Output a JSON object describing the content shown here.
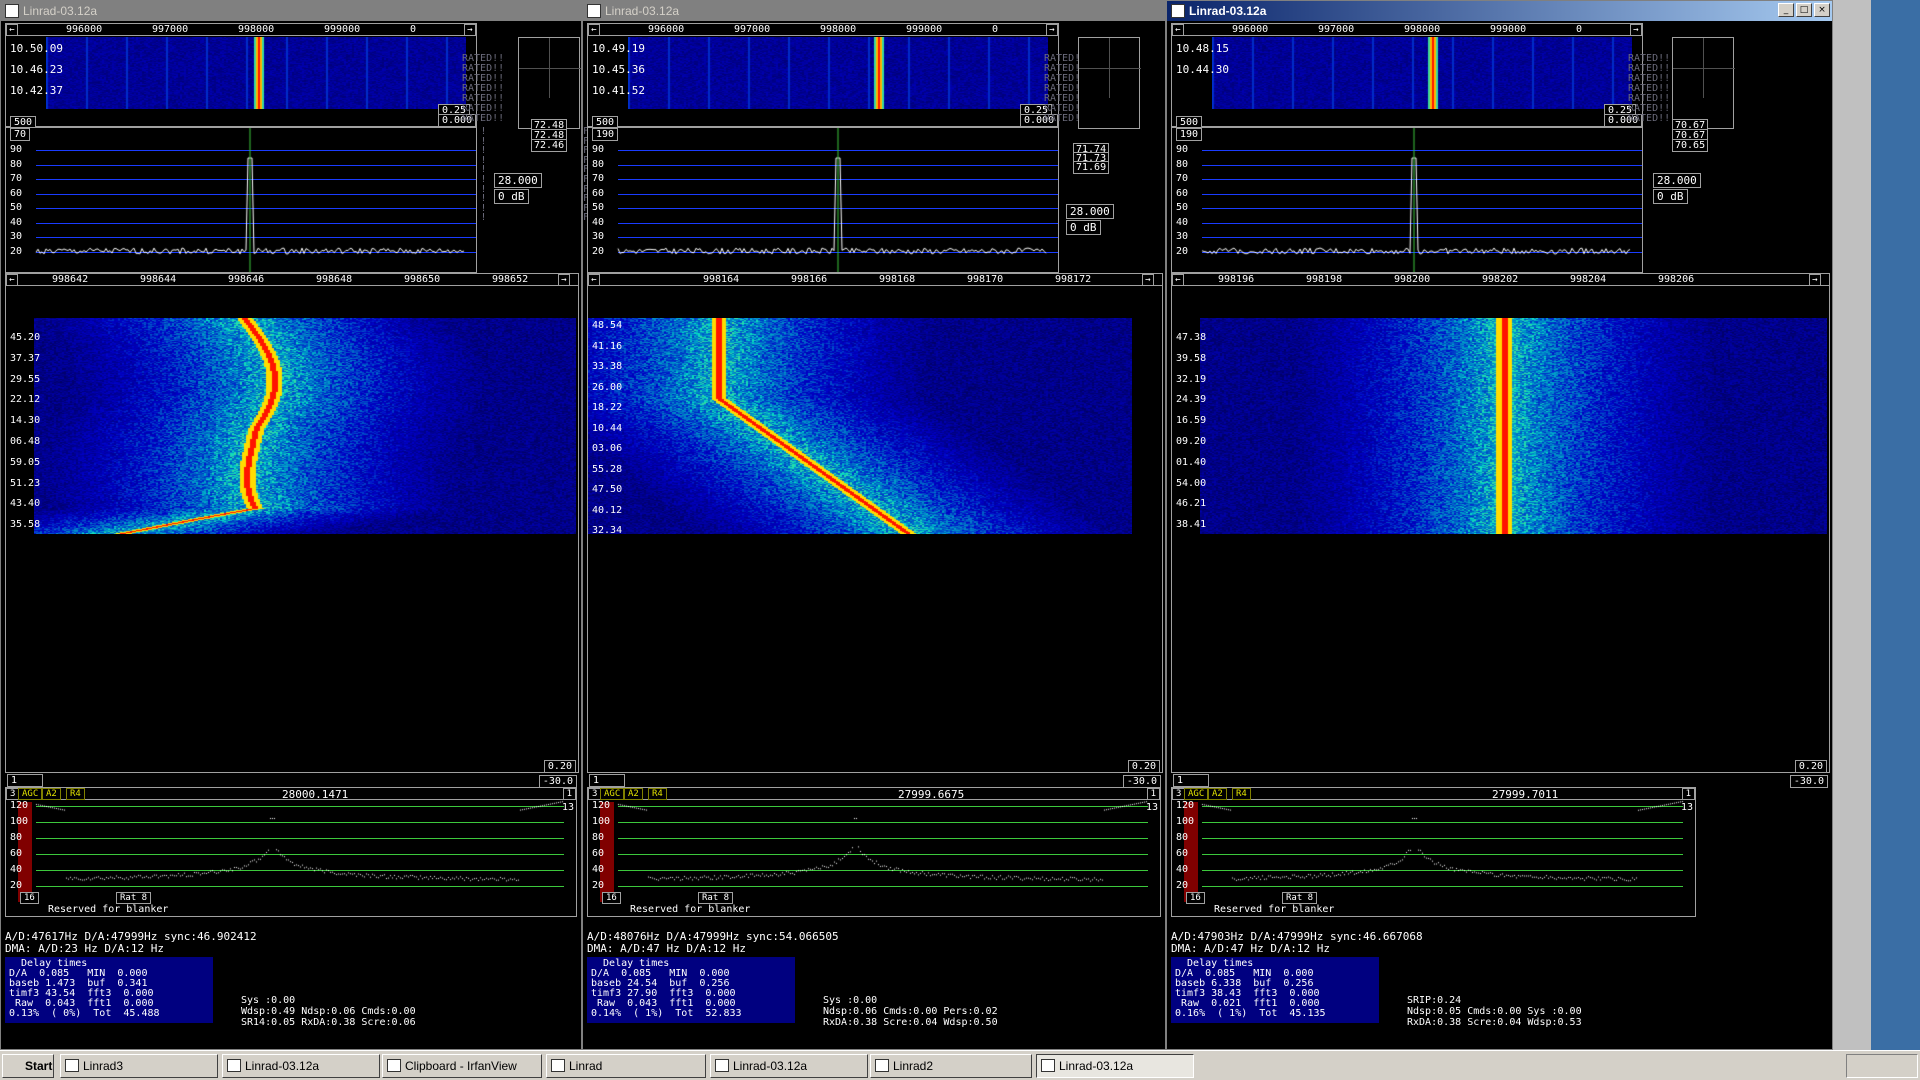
{
  "desktop": {
    "bg": "#3a6ea5"
  },
  "windows": [
    {
      "title": "Linrad-03.12a",
      "wide_scale": [
        "996000",
        "997000",
        "998000",
        "999000",
        "0"
      ],
      "times": [
        "10.50.09",
        "10.46.23",
        "10.42.37"
      ],
      "wf_box_top": "0.25",
      "wf_box_bot": "0.000",
      "left_box": "500",
      "left_box2": "70",
      "spec_ylabels": [
        "90",
        "80",
        "70",
        "60",
        "50",
        "40",
        "30",
        "20"
      ],
      "meter": [
        "72.48",
        "72.48",
        "72.46"
      ],
      "gain_box": "28.000",
      "db_box": "0 dB",
      "hires_scale": [
        "998642",
        "998644",
        "998646",
        "998648",
        "998650",
        "998652"
      ],
      "hires_times": [
        "45.20",
        "37.37",
        "29.55",
        "22.12",
        "14.30",
        "06.48",
        "59.05",
        "51.23",
        "43.40",
        "35.58"
      ],
      "bsd_top": "0.20",
      "bsd_bot": "-30.0",
      "one": "1",
      "freq": "28000.1471",
      "bsd_ylabels": [
        "120",
        "100",
        "80",
        "60",
        "40",
        "20"
      ],
      "agc": "AGC",
      "a2": "A2",
      "r4": "R4",
      "three": "3",
      "thirteen": "13",
      "ctrl": "Reserved for blanker",
      "ctrl_num": "16",
      "rat": "Rat  8",
      "status1": "A/D:47617Hz  D/A:47999Hz sync:46.902412",
      "status2": "DMA:  A/D:23 Hz    D/A:12 Hz",
      "delay": "  Delay times\nD/A  0.085   MIN  0.000\nbaseb 1.473  buf  0.341\ntimf3 43.54  fft3  0.000\n Raw  0.043  fft1  0.000\n0.13%  ( 0%)  Tot  45.488",
      "stats": [
        "Sys :0.00",
        "Wdsp:0.49  Ndsp:0.06  Cmds:0.00",
        "SR14:0.05  RxDA:0.38  Scre:0.06"
      ]
    },
    {
      "title": "Linrad-03.12a",
      "wide_scale": [
        "996000",
        "997000",
        "998000",
        "999000",
        "0"
      ],
      "times": [
        "10.49.19",
        "10.45.36",
        "10.41.52"
      ],
      "wf_box_top": "0.25",
      "wf_box_bot": "0.000",
      "left_box": "500",
      "left_box2": "190",
      "spec_ylabels": [
        "90",
        "80",
        "70",
        "60",
        "50",
        "40",
        "30",
        "20"
      ],
      "meter": [
        "71.74",
        "71.73",
        "71.69"
      ],
      "gain_box": "28.000",
      "db_box": "0 dB",
      "hires_scale": [
        "998164",
        "998166",
        "998168",
        "998170",
        "998172"
      ],
      "hires_times": [
        "48.54",
        "41.16",
        "33.38",
        "26.00",
        "18.22",
        "10.44",
        "03.06",
        "55.28",
        "47.50",
        "40.12",
        "32.34"
      ],
      "bsd_top": "0.20",
      "bsd_bot": "-30.0",
      "one": "1",
      "freq": "27999.6675",
      "bsd_ylabels": [
        "120",
        "100",
        "80",
        "60",
        "40",
        "20"
      ],
      "agc": "AGC",
      "a2": "A2",
      "r4": "R4",
      "three": "3",
      "thirteen": "13",
      "ctrl": "Reserved for blanker",
      "ctrl_num": "16",
      "rat": "Rat  8",
      "status1": "A/D:48076Hz  D/A:47999Hz sync:54.066505",
      "status2": "DMA:  A/D:47 Hz    D/A:12 Hz",
      "delay": "  Delay times\nD/A  0.085   MIN  0.000\nbaseb 24.54  buf  0.256\ntimf3 27.90  fft3  0.000\n Raw  0.043  fft1  0.000\n0.14%  ( 1%)  Tot  52.833",
      "stats": [
        "Sys :0.00",
        "Ndsp:0.06  Cmds:0.00  Pers:0.02",
        "RxDA:0.38  Scre:0.04  Wdsp:0.50"
      ]
    },
    {
      "title": "Linrad-03.12a",
      "wide_scale": [
        "996000",
        "997000",
        "998000",
        "999000",
        "0"
      ],
      "times": [
        "10.48.15",
        "10.44.30"
      ],
      "wf_box_top": "0.25",
      "wf_box_bot": "0.000",
      "left_box": "500",
      "left_box2": "190",
      "spec_ylabels": [
        "90",
        "80",
        "70",
        "60",
        "50",
        "40",
        "30",
        "20"
      ],
      "meter": [
        "70.67",
        "70.67",
        "70.65"
      ],
      "gain_box": "28.000",
      "db_box": "0 dB",
      "hires_scale": [
        "998196",
        "998198",
        "998200",
        "998202",
        "998204",
        "998206"
      ],
      "hires_times": [
        "47.38",
        "39.58",
        "32.19",
        "24.39",
        "16.59",
        "09.20",
        "01.40",
        "54.00",
        "46.21",
        "38.41"
      ],
      "bsd_top": "0.20",
      "bsd_bot": "-30.0",
      "one": "1",
      "freq": "27999.7011",
      "bsd_ylabels": [
        "120",
        "100",
        "80",
        "60",
        "40",
        "20"
      ],
      "agc": "AGC",
      "a2": "A2",
      "r4": "R4",
      "three": "3",
      "thirteen": "13",
      "ctrl": "Reserved for blanker",
      "ctrl_num": "16",
      "rat": "Rat  8",
      "status1": "A/D:47903Hz  D/A:47999Hz sync:46.667068",
      "status2": "DMA:  A/D:47 Hz    D/A:12 Hz",
      "delay": "  Delay times\nD/A  0.085   MIN  0.000\nbaseb 6.338  buf  0.256\ntimf3 38.43  fft3  0.000\n Raw  0.021  fft1  0.000\n0.16%  ( 1%)  Tot  45.135",
      "stats": [
        "SRIP:0.24",
        "Ndsp:0.05  Cmds:0.00  Sys :0.00",
        "RxDA:0.38  Scre:0.04  Wdsp:0.53"
      ]
    }
  ],
  "filters_text": "FILTERS NOT CALIBRATED!!",
  "rated_text": "RATED!!",
  "taskbar": {
    "start": "Start",
    "tasks": [
      "Linrad3",
      "Linrad-03.12a",
      "Clipboard - IrfanView",
      "Linrad",
      "Linrad-03.12a",
      "Linrad2",
      "Linrad-03.12a"
    ]
  }
}
